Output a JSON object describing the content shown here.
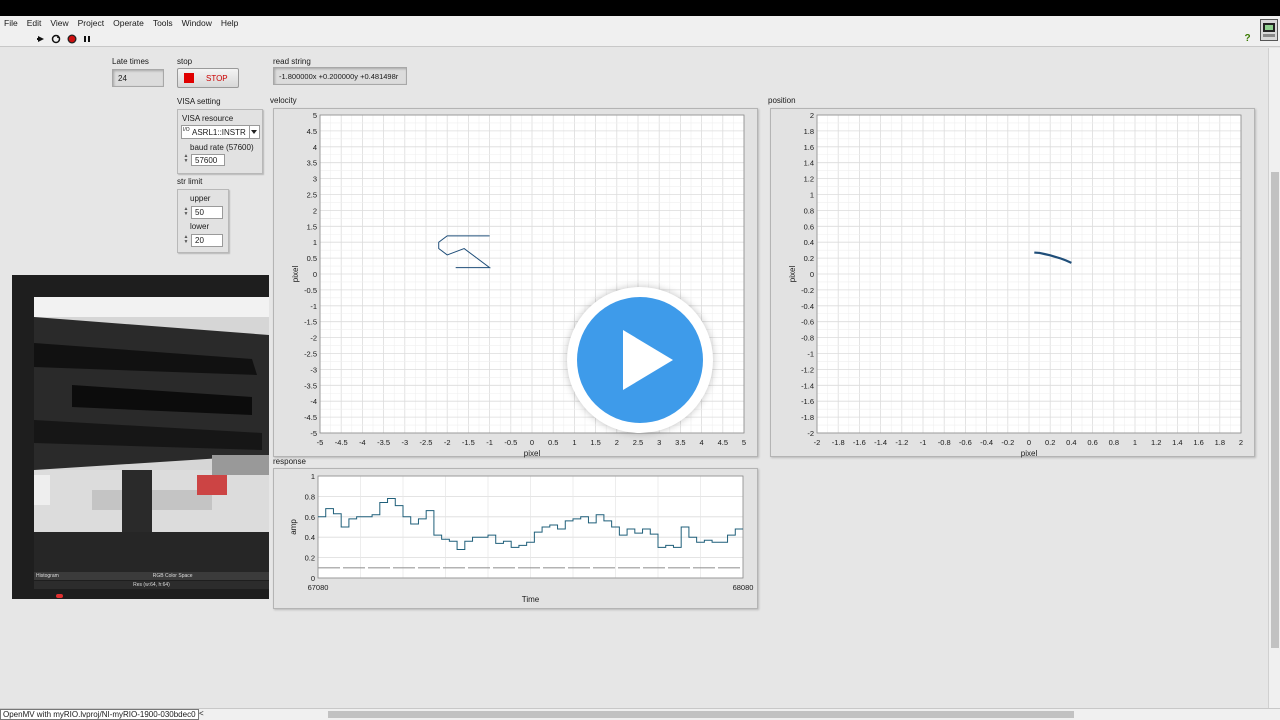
{
  "menu": [
    "File",
    "Edit",
    "View",
    "Project",
    "Operate",
    "Tools",
    "Window",
    "Help"
  ],
  "toolbar": {
    "icons": [
      "run-arrow-icon",
      "run-continuously-icon",
      "abort-icon",
      "pause-icon"
    ],
    "help": "?"
  },
  "late_times": {
    "label": "Late times",
    "value": "24"
  },
  "stop": {
    "label": "stop",
    "button": "STOP"
  },
  "read_string": {
    "label": "read string",
    "value": "-1.800000x +0.200000y +0.481498r"
  },
  "visa": {
    "label": "VISA setting",
    "resource_label": "VISA resource",
    "resource_value": "ASRL1::INSTR",
    "resource_prefix": "I/O",
    "baud_label": "baud rate (57600)",
    "baud_value": "57600"
  },
  "str_limit": {
    "label": "str limit",
    "upper_label": "upper",
    "upper_value": "50",
    "lower_label": "lower",
    "lower_value": "20"
  },
  "video": {
    "panel_label": "Histogram",
    "color_space": "RGB Color Space",
    "res": "Res (w:64, h:64)"
  },
  "chart_data": [
    {
      "type": "line",
      "title": "velocity",
      "xlabel": "pixel",
      "ylabel": "pixel",
      "xlim": [
        -5,
        5
      ],
      "ylim": [
        -5,
        5
      ],
      "xticks": [
        "-5",
        "-4.5",
        "-4",
        "-3.5",
        "-3",
        "-2.5",
        "-2",
        "-1.5",
        "-1",
        "-0.5",
        "0",
        "0.5",
        "1",
        "1.5",
        "2",
        "2.5",
        "3",
        "3.5",
        "4",
        "4.5",
        "5"
      ],
      "yticks": [
        "5",
        "4.5",
        "4",
        "3.5",
        "3",
        "2.5",
        "2",
        "1.5",
        "1",
        "0.5",
        "0",
        "-0.5",
        "-1",
        "-1.5",
        "-2",
        "-2.5",
        "-3",
        "-3.5",
        "-4",
        "-4.5",
        "-5"
      ],
      "grid": true,
      "series": [
        {
          "x": [
            -1.0,
            -2.0,
            -2.2,
            -2.2,
            -2.0,
            -1.6,
            -1.0,
            -1.8
          ],
          "y": [
            1.2,
            1.2,
            1.0,
            0.8,
            0.6,
            0.8,
            0.2,
            0.2
          ]
        }
      ]
    },
    {
      "type": "line",
      "title": "position",
      "xlabel": "pixel",
      "ylabel": "pixel",
      "xlim": [
        -2,
        2
      ],
      "ylim": [
        -2,
        2
      ],
      "xticks": [
        "-2",
        "-1.8",
        "-1.6",
        "-1.4",
        "-1.2",
        "-1",
        "-0.8",
        "-0.6",
        "-0.4",
        "-0.2",
        "0",
        "0.2",
        "0.4",
        "0.6",
        "0.8",
        "1",
        "1.2",
        "1.4",
        "1.6",
        "1.8",
        "2"
      ],
      "yticks": [
        "2",
        "1.8",
        "1.6",
        "1.4",
        "1.2",
        "1",
        "0.8",
        "0.6",
        "0.4",
        "0.2",
        "0",
        "-0.2",
        "-0.4",
        "-0.6",
        "-0.8",
        "-1",
        "-1.2",
        "-1.4",
        "-1.6",
        "-1.8",
        "-2"
      ],
      "grid": true,
      "series": [
        {
          "x": [
            0.05,
            0.1,
            0.15,
            0.2,
            0.25,
            0.3,
            0.35,
            0.4
          ],
          "y": [
            0.27,
            0.265,
            0.25,
            0.235,
            0.215,
            0.195,
            0.17,
            0.14
          ]
        }
      ]
    },
    {
      "type": "line",
      "title": "response",
      "xlabel": "Time",
      "ylabel": "amp",
      "xlim": [
        67080,
        68080
      ],
      "ylim": [
        0,
        1
      ],
      "xticks": [
        "67080",
        "68080"
      ],
      "yticks": [
        "1",
        "0.8",
        "0.6",
        "0.4",
        "0.2",
        "0"
      ],
      "grid": true,
      "series": [
        {
          "step": true,
          "values": [
            0.6,
            0.68,
            0.63,
            0.5,
            0.58,
            0.6,
            0.6,
            0.62,
            0.74,
            0.78,
            0.71,
            0.6,
            0.53,
            0.58,
            0.66,
            0.42,
            0.38,
            0.36,
            0.28,
            0.36,
            0.4,
            0.4,
            0.42,
            0.34,
            0.36,
            0.3,
            0.32,
            0.35,
            0.45,
            0.5,
            0.52,
            0.48,
            0.56,
            0.58,
            0.6,
            0.54,
            0.62,
            0.56,
            0.5,
            0.42,
            0.48,
            0.44,
            0.48,
            0.43,
            0.3,
            0.32,
            0.3,
            0.5,
            0.4,
            0.35,
            0.37,
            0.35,
            0.35,
            0.42,
            0.48
          ]
        },
        {
          "dashed": true,
          "values": [
            0.1,
            0.1
          ]
        }
      ]
    }
  ]
}
